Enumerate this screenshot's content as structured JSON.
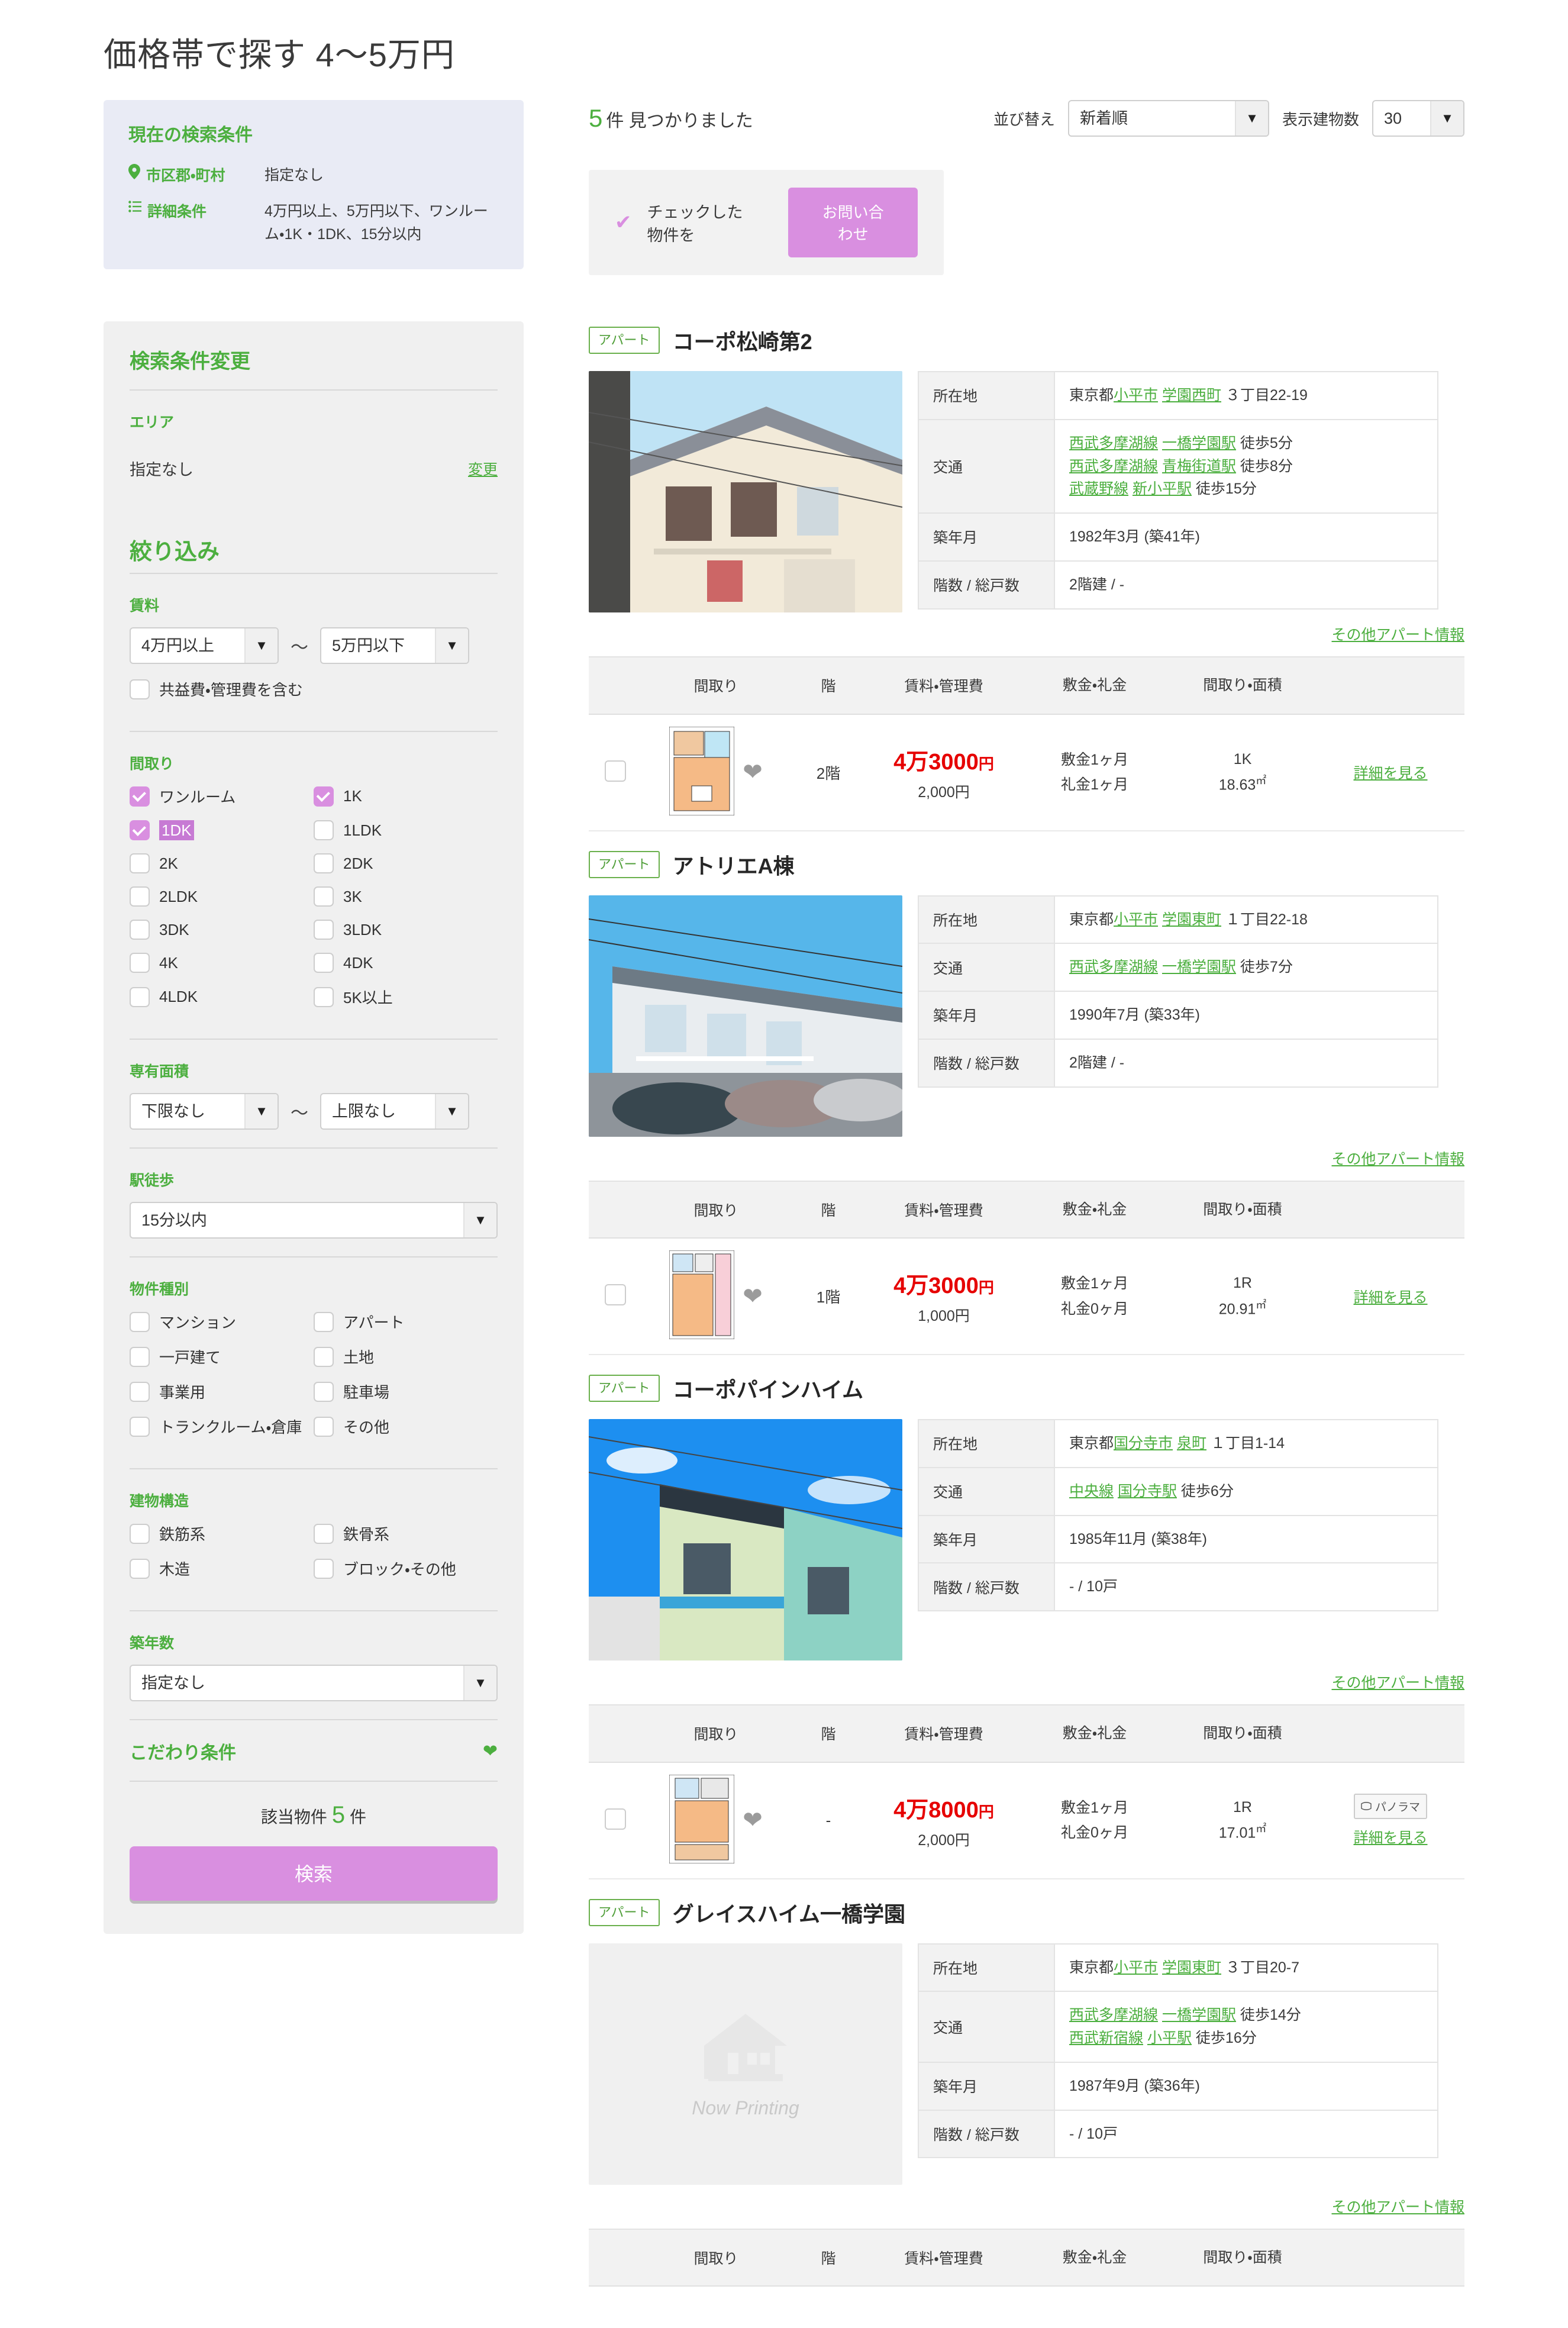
{
  "page": {
    "title": "価格帯で探す 4〜5万円"
  },
  "current_conditions": {
    "title": "現在の検索条件",
    "rows": [
      {
        "icon": "pin-icon",
        "label": "市区郡・町村",
        "value": "指定なし"
      },
      {
        "icon": "list-icon",
        "label": "詳細条件",
        "value": "4万円以上、5万円以下、ワンルーム・1K・1DK、15分以内"
      }
    ]
  },
  "filter": {
    "heading": "検索条件変更",
    "area": {
      "label": "エリア",
      "value": "指定なし",
      "change_label": "変更"
    },
    "refine_heading": "絞り込み",
    "rent": {
      "label": "賃料",
      "min": "4万円以上",
      "max": "5万円以下",
      "separator": "〜",
      "include_fee_label": "共益費・管理費を含む",
      "include_fee_checked": false
    },
    "layout": {
      "label": "間取り",
      "items": [
        {
          "label": "ワンルーム",
          "checked": true
        },
        {
          "label": "1K",
          "checked": true
        },
        {
          "label": "1DK",
          "checked": true,
          "highlighted": true
        },
        {
          "label": "1LDK",
          "checked": false
        },
        {
          "label": "2K",
          "checked": false
        },
        {
          "label": "2DK",
          "checked": false
        },
        {
          "label": "2LDK",
          "checked": false
        },
        {
          "label": "3K",
          "checked": false
        },
        {
          "label": "3DK",
          "checked": false
        },
        {
          "label": "3LDK",
          "checked": false
        },
        {
          "label": "4K",
          "checked": false
        },
        {
          "label": "4DK",
          "checked": false
        },
        {
          "label": "4LDK",
          "checked": false
        },
        {
          "label": "5K以上",
          "checked": false
        }
      ]
    },
    "area_size": {
      "label": "専有面積",
      "min": "下限なし",
      "max": "上限なし",
      "separator": "〜"
    },
    "walk": {
      "label": "駅徒歩",
      "value": "15分以内"
    },
    "property_type": {
      "label": "物件種別",
      "items": [
        {
          "label": "マンション",
          "checked": false
        },
        {
          "label": "アパート",
          "checked": false
        },
        {
          "label": "一戸建て",
          "checked": false
        },
        {
          "label": "土地",
          "checked": false
        },
        {
          "label": "事業用",
          "checked": false
        },
        {
          "label": "駐車場",
          "checked": false
        },
        {
          "label": "トランクルーム・倉庫",
          "checked": false
        },
        {
          "label": "その他",
          "checked": false
        }
      ]
    },
    "structure": {
      "label": "建物構造",
      "items": [
        {
          "label": "鉄筋系",
          "checked": false
        },
        {
          "label": "鉄骨系",
          "checked": false
        },
        {
          "label": "木造",
          "checked": false
        },
        {
          "label": "ブロック・その他",
          "checked": false
        }
      ]
    },
    "age": {
      "label": "築年数",
      "value": "指定なし"
    },
    "kodawari": {
      "label": "こだわり条件"
    },
    "hit_count": {
      "prefix": "該当物件",
      "count": "5",
      "suffix": "件"
    },
    "search_button": "検索"
  },
  "results": {
    "count_prefix": "5",
    "count_text": "件 見つかりました",
    "sort_label": "並び替え",
    "sort_value": "新着順",
    "per_page_label": "表示建物数",
    "per_page_value": "30",
    "inquiry": {
      "text": "チェックした物件を",
      "button": "お問い合わせ"
    },
    "unit_columns": [
      "間取り",
      "階",
      "賃料・管理費",
      "敷金・礼金",
      "間取り・面積"
    ],
    "other_info_label": "その他アパート情報",
    "detail_label": "詳細を見る",
    "panorama_label": "パノラマ",
    "spec_labels": {
      "address": "所在地",
      "access": "交通",
      "built": "築年月",
      "floors": "階数 / 総戸数"
    },
    "now_printing": "Now Printing",
    "properties": [
      {
        "type_badge": "アパート",
        "name": "コーポ松崎第2",
        "photo": "exterior-photo-beige-apartment",
        "address_pre": "東京都",
        "address_links": [
          "小平市",
          "学園西町"
        ],
        "address_post": "３丁目22-19",
        "access": [
          {
            "line": "西武多摩湖線",
            "station": "一橋学園駅",
            "walk": "徒歩5分"
          },
          {
            "line": "西武多摩湖線",
            "station": "青梅街道駅",
            "walk": "徒歩8分"
          },
          {
            "line": "武蔵野線",
            "station": "新小平駅",
            "walk": "徒歩15分"
          }
        ],
        "built": "1982年3月 (築41年)",
        "floors": "2階建 / -",
        "units": [
          {
            "floor": "2階",
            "rent": "4万3000",
            "rent_unit": "円",
            "admin_fee": "2,000円",
            "deposit": "敷金1ヶ月",
            "key_money": "礼金1ヶ月",
            "layout": "1K",
            "size": "18.63",
            "panorama": false
          }
        ]
      },
      {
        "type_badge": "アパート",
        "name": "アトリエA棟",
        "photo": "exterior-photo-white-townhouse",
        "address_pre": "東京都",
        "address_links": [
          "小平市",
          "学園東町"
        ],
        "address_post": "１丁目22-18",
        "access": [
          {
            "line": "西武多摩湖線",
            "station": "一橋学園駅",
            "walk": "徒歩7分"
          }
        ],
        "built": "1990年7月 (築33年)",
        "floors": "2階建 / -",
        "units": [
          {
            "floor": "1階",
            "rent": "4万3000",
            "rent_unit": "円",
            "admin_fee": "1,000円",
            "deposit": "敷金1ヶ月",
            "key_money": "礼金0ヶ月",
            "layout": "1R",
            "size": "20.91",
            "panorama": false
          }
        ]
      },
      {
        "type_badge": "アパート",
        "name": "コーポパインハイム",
        "photo": "exterior-photo-green-apartment",
        "address_pre": "東京都",
        "address_links": [
          "国分寺市",
          "泉町"
        ],
        "address_post": "１丁目1-14",
        "access": [
          {
            "line": "中央線",
            "station": "国分寺駅",
            "walk": "徒歩6分"
          }
        ],
        "built": "1985年11月 (築38年)",
        "floors": "- / 10戸",
        "units": [
          {
            "floor": "-",
            "rent": "4万8000",
            "rent_unit": "円",
            "admin_fee": "2,000円",
            "deposit": "敷金1ヶ月",
            "key_money": "礼金0ヶ月",
            "layout": "1R",
            "size": "17.01",
            "panorama": true
          }
        ]
      },
      {
        "type_badge": "アパート",
        "name": "グレイスハイム一橋学園",
        "photo": "now-printing-placeholder",
        "address_pre": "東京都",
        "address_links": [
          "小平市",
          "学園東町"
        ],
        "address_post": "３丁目20-7",
        "access": [
          {
            "line": "西武多摩湖線",
            "station": "一橋学園駅",
            "walk": "徒歩14分"
          },
          {
            "line": "西武新宿線",
            "station": "小平駅",
            "walk": "徒歩16分"
          }
        ],
        "built": "1987年9月 (築36年)",
        "floors": "- / 10戸",
        "units": []
      }
    ]
  }
}
